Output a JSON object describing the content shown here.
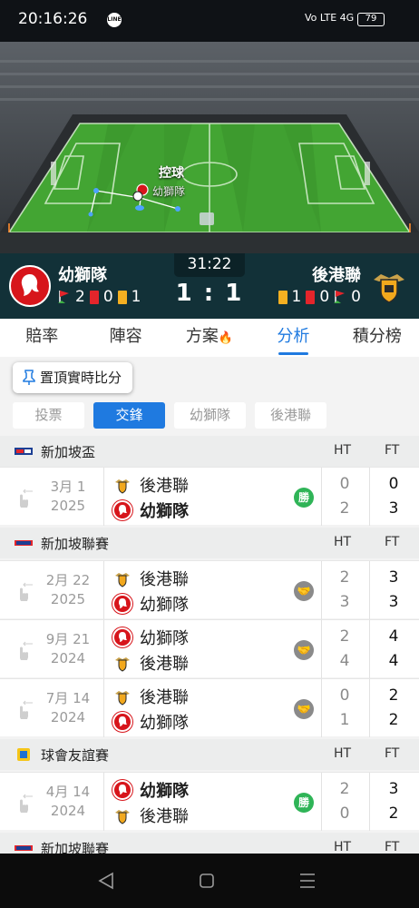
{
  "status_bar": {
    "time": "20:16:26",
    "network": "Vo LTE 4G",
    "battery": "79"
  },
  "pitch": {
    "possession_label": "控球",
    "possession_team": "幼獅隊"
  },
  "match": {
    "clock": "31:22",
    "score": "1 : 1",
    "home": {
      "name": "幼獅隊",
      "corners": "2",
      "red_cards": "0",
      "yellow_cards": "1"
    },
    "away": {
      "name": "後港聯",
      "yellow_cards": "1",
      "red_cards": "0",
      "corners": "0"
    }
  },
  "tabs": [
    {
      "label": "賠率"
    },
    {
      "label": "陣容"
    },
    {
      "label": "方案"
    },
    {
      "label": "分析"
    },
    {
      "label": "積分榜"
    }
  ],
  "active_tab": "分析",
  "pin_button": "置頂實時比分",
  "filters": [
    {
      "label": "投票"
    },
    {
      "label": "交鋒"
    },
    {
      "label": "幼獅隊"
    },
    {
      "label": "後港聯"
    }
  ],
  "column_headers": {
    "ht": "HT",
    "ft": "FT"
  },
  "sections": [
    {
      "name": "新加坡盃",
      "matches": [
        {
          "date_md": "3月 1",
          "year": "2025",
          "team1": "後港聯",
          "team2": "幼獅隊",
          "result": "勝",
          "result_type": "win",
          "ht": [
            "0",
            "2"
          ],
          "ft": [
            "0",
            "3"
          ]
        }
      ]
    },
    {
      "name": "新加坡聯賽",
      "matches": [
        {
          "date_md": "2月 22",
          "year": "2025",
          "team1": "後港聯",
          "team2": "幼獅隊",
          "result_type": "draw",
          "ht": [
            "2",
            "3"
          ],
          "ft": [
            "3",
            "3"
          ]
        },
        {
          "date_md": "9月 21",
          "year": "2024",
          "team1": "幼獅隊",
          "team2": "後港聯",
          "result_type": "draw",
          "ht": [
            "2",
            "4"
          ],
          "ft": [
            "4",
            "4"
          ]
        },
        {
          "date_md": "7月 14",
          "year": "2024",
          "team1": "後港聯",
          "team2": "幼獅隊",
          "result_type": "draw",
          "ht": [
            "0",
            "1"
          ],
          "ft": [
            "2",
            "2"
          ]
        }
      ]
    },
    {
      "name": "球會友誼賽",
      "matches": [
        {
          "date_md": "4月 14",
          "year": "2024",
          "team1": "幼獅隊",
          "team2": "後港聯",
          "result": "勝",
          "result_type": "win",
          "ht": [
            "2",
            "0"
          ],
          "ft": [
            "3",
            "2"
          ]
        }
      ]
    },
    {
      "name": "新加坡聯賽",
      "matches": []
    }
  ],
  "colors": {
    "accent": "#1f7ae0",
    "win": "#2fb457",
    "draw": "#8a8a8a",
    "scorebar": "#123138"
  }
}
